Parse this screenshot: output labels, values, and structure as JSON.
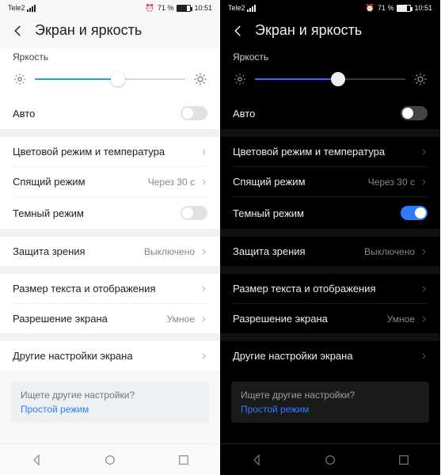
{
  "status": {
    "carrier": "Tele2",
    "battery_pct": "71 %",
    "time": "10:51"
  },
  "header": {
    "title": "Экран и яркость"
  },
  "brightness": {
    "label": "Яркость",
    "percent": 55
  },
  "rows": {
    "auto": "Авто",
    "color_mode": "Цветовой режим и температура",
    "sleep": "Спящий режим",
    "sleep_value": "Через 30 с",
    "dark_mode": "Темный режим",
    "eye_comfort": "Защита зрения",
    "eye_comfort_value": "Выключено",
    "text_size": "Размер текста и отображения",
    "resolution": "Разрешение экрана",
    "resolution_value": "Умное",
    "more": "Другие настройки экрана"
  },
  "hint": {
    "question": "Ищете другие настройки?",
    "link": "Простой режим"
  }
}
